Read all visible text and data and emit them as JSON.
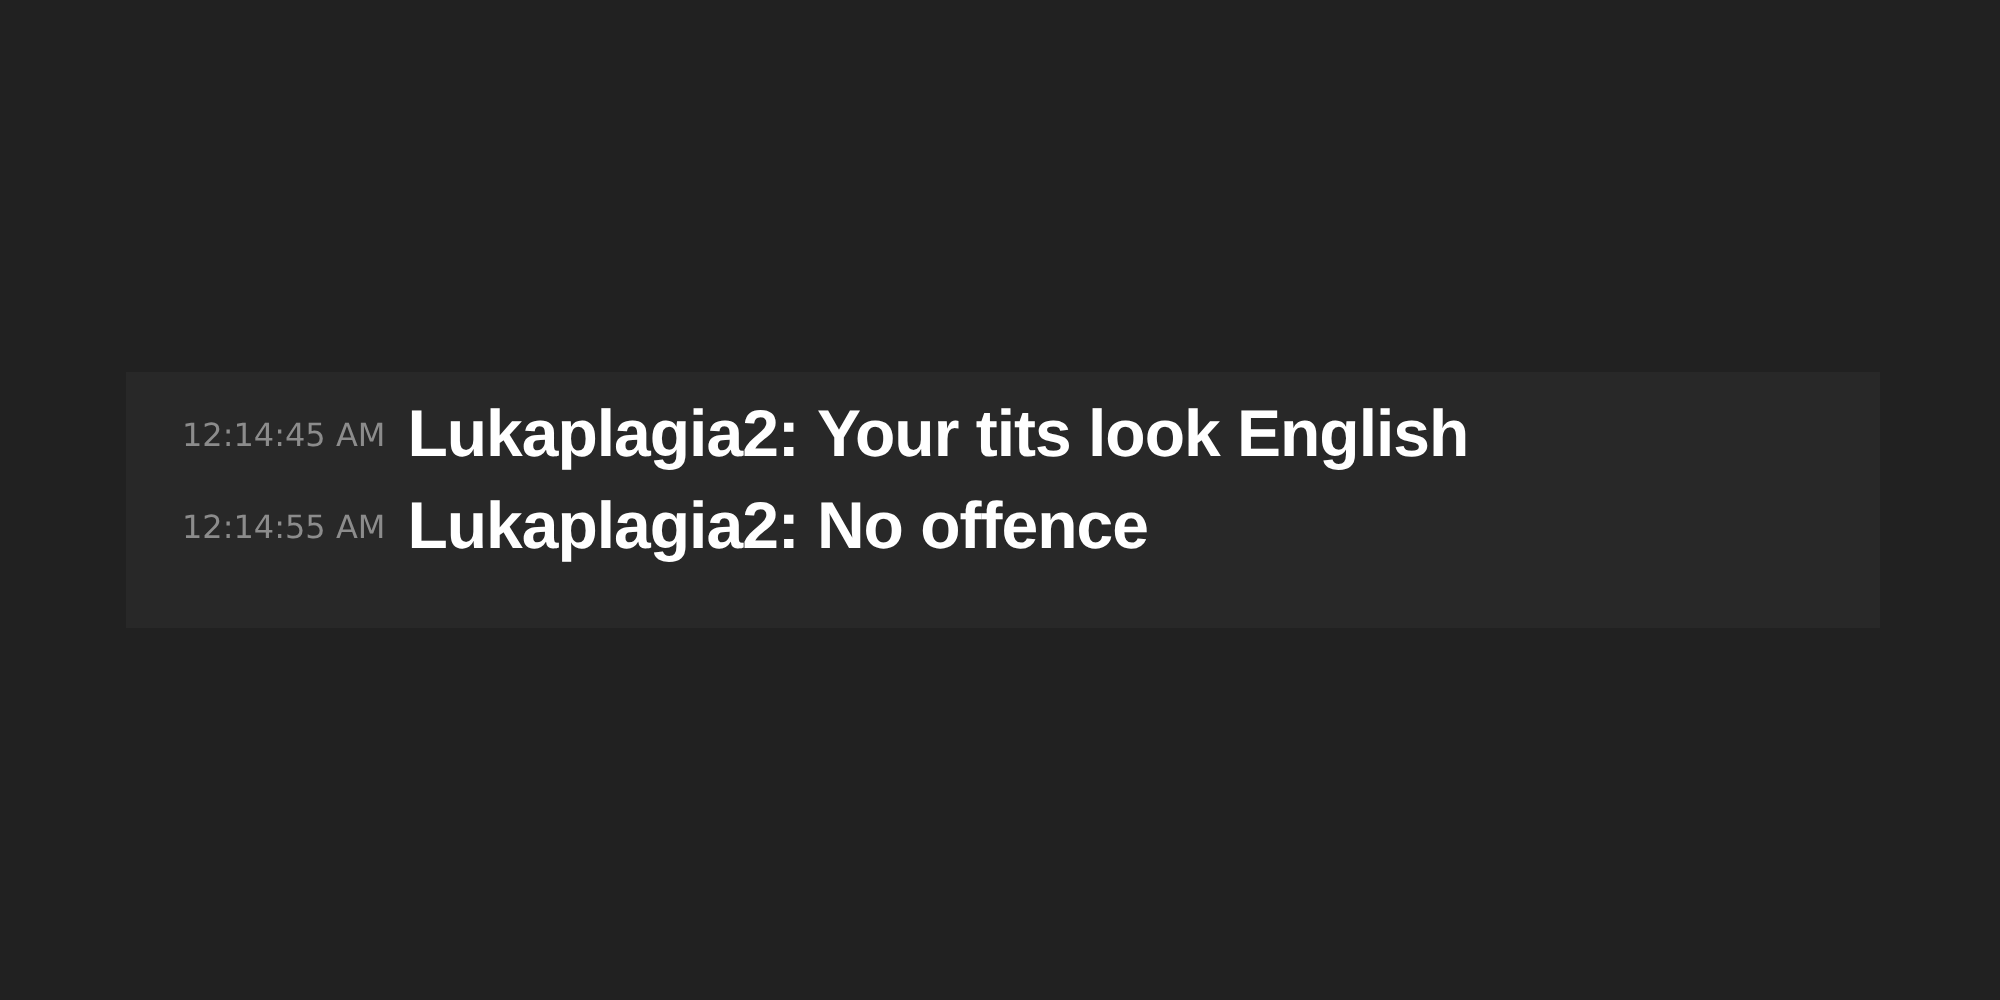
{
  "chat": {
    "messages": [
      {
        "time": "12:14:45 AM",
        "author": "Lukaplagia2:",
        "text": "Your tits look English"
      },
      {
        "time": "12:14:55 AM",
        "author": "Lukaplagia2:",
        "text": "No offence"
      }
    ]
  }
}
